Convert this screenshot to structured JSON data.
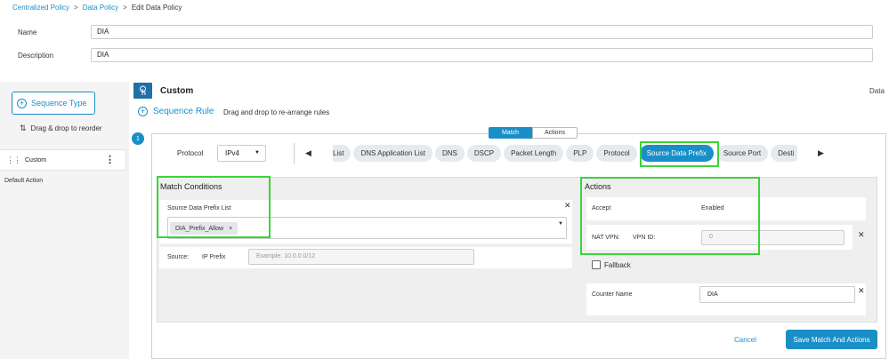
{
  "breadcrumb": {
    "items": [
      "Centralized Policy",
      "Data Policy"
    ],
    "current": "Edit Data Policy"
  },
  "form": {
    "name_label": "Name",
    "name_value": "DIA",
    "description_label": "Description",
    "description_value": "DIA"
  },
  "sidebar": {
    "sequence_type_label": "Sequence Type",
    "drag_hint": "Drag & drop to reorder",
    "custom_label": "Custom",
    "default_action_label": "Default Action"
  },
  "header": {
    "title": "Custom",
    "right_cut_text": "Data",
    "sequence_rule_label": "Sequence Rule",
    "sequence_rule_hint": "Drag and drop to re-arrange rules"
  },
  "sequence": {
    "number": "1",
    "tabs": {
      "match": "Match",
      "actions": "Actions"
    },
    "protocol_label": "Protocol",
    "protocol_value": "IPv4",
    "chips": [
      "List",
      "DNS Application List",
      "DNS",
      "DSCP",
      "Packet Length",
      "PLP",
      "Protocol",
      "Source Data Prefix",
      "Source Port",
      "Desti"
    ],
    "active_chip": "Source Data Prefix"
  },
  "match_conditions": {
    "title": "Match Conditions",
    "prefix_list_label": "Source Data Prefix List",
    "prefix_tag": "DIA_Prefix_Allow",
    "source_label": "Source:",
    "ip_prefix_label": "IP Prefix",
    "ip_prefix_placeholder": "Example: 10.0.0.0/12"
  },
  "actions": {
    "title": "Actions",
    "accept_label": "Accept",
    "accept_value": "Enabled",
    "nat_vpn_label": "NAT VPN:",
    "vpn_id_label": "VPN ID:",
    "vpn_id_value": "0",
    "fallback_label": "Fallback",
    "counter_name_label": "Counter Name",
    "counter_name_value": "DIA"
  },
  "footer": {
    "cancel_label": "Cancel",
    "save_label": "Save Match And Actions"
  },
  "colors": {
    "accent": "#1a8fc7",
    "highlight": "#3ad43a"
  }
}
